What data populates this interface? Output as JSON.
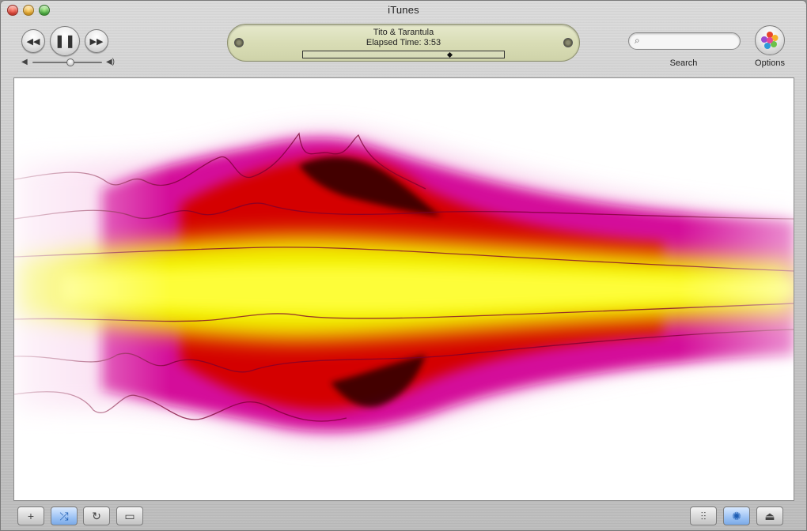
{
  "window": {
    "title": "iTunes"
  },
  "transport": {
    "previous_icon": "rewind-icon",
    "play_pause_icon": "pause-icon",
    "next_icon": "fast-forward-icon"
  },
  "volume": {
    "level": 0.55
  },
  "lcd": {
    "track": "Tito & Tarantula",
    "elapsed": "Elapsed Time: 3:53",
    "progress": 0.74
  },
  "search": {
    "placeholder": "",
    "label": "Search"
  },
  "options": {
    "label": "Options"
  },
  "bottom_bar": {
    "add_icon": "plus-icon",
    "shuffle_icon": "shuffle-icon",
    "repeat_icon": "repeat-icon",
    "artwork_icon": "artwork-icon",
    "equalizer_icon": "equalizer-icon",
    "visualizer_icon": "visualizer-gear-icon",
    "eject_icon": "eject-icon"
  },
  "colors": {
    "viz_magenta": "#d4109a",
    "viz_red": "#d40000",
    "viz_yellow": "#f2ee00",
    "viz_dark": "#1a0000"
  }
}
